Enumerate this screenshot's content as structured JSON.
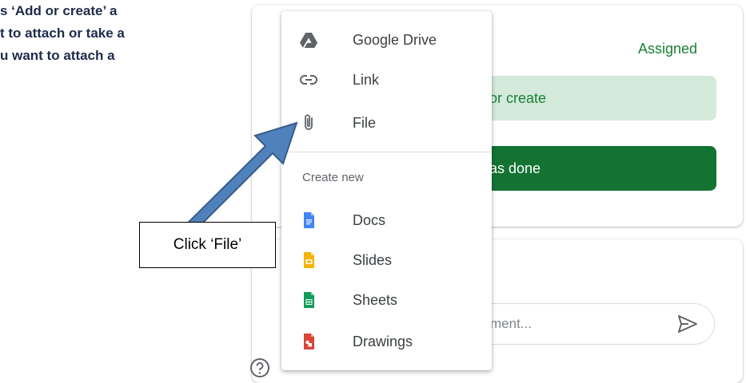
{
  "instructions": {
    "line1": "s ‘Add or create’ a",
    "line2": "t to attach or take a",
    "line3": "u want to attach a"
  },
  "classroom": {
    "status": "Assigned",
    "add_create_label": "or create",
    "mark_done_label": "as done",
    "comment_placeholder": "ment..."
  },
  "menu": {
    "items": [
      {
        "label": "Google Drive",
        "icon": "google-drive-icon"
      },
      {
        "label": "Link",
        "icon": "link-icon"
      },
      {
        "label": "File",
        "icon": "paperclip-icon"
      }
    ],
    "create_new_label": "Create new",
    "create_items": [
      {
        "label": "Docs",
        "icon": "docs-icon",
        "color": "#4285f4"
      },
      {
        "label": "Slides",
        "icon": "slides-icon",
        "color": "#f4b400"
      },
      {
        "label": "Sheets",
        "icon": "sheets-icon",
        "color": "#0f9d58"
      },
      {
        "label": "Drawings",
        "icon": "drawings-icon",
        "color": "#db4437"
      }
    ]
  },
  "callout": {
    "text": "Click ‘File’"
  },
  "colors": {
    "accent_green": "#188038",
    "done_green": "#137333",
    "light_green": "#d4eadb",
    "arrow_fill": "#4f81bd",
    "arrow_stroke": "#385d8a"
  }
}
